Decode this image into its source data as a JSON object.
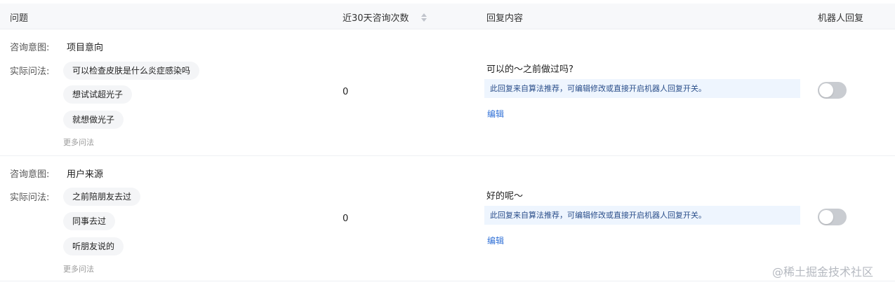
{
  "header": {
    "question": "问题",
    "count": "近30天咨询次数",
    "reply": "回复内容",
    "robot": "机器人回复"
  },
  "labels": {
    "intent": "咨询意图:",
    "phrasings": "实际问法:",
    "more": "更多问法",
    "edit": "编辑"
  },
  "rows": [
    {
      "intent": "项目意向",
      "phrasings": [
        "可以检查皮肤是什么炎症感染吗",
        "想试试超光子",
        "就想做光子"
      ],
      "count": "0",
      "reply": "可以的～之前做过吗?",
      "notice": "此回复来自算法推荐，可编辑修改或直接开启机器人回复开关。",
      "robot_enabled": false
    },
    {
      "intent": "用户来源",
      "phrasings": [
        "之前陪朋友去过",
        "同事去过",
        "听朋友说的"
      ],
      "count": "0",
      "reply": "好的呢～",
      "notice": "此回复来自算法推荐，可编辑修改或直接开启机器人回复开关。",
      "robot_enabled": false
    }
  ],
  "watermark": "@稀土掘金技术社区"
}
